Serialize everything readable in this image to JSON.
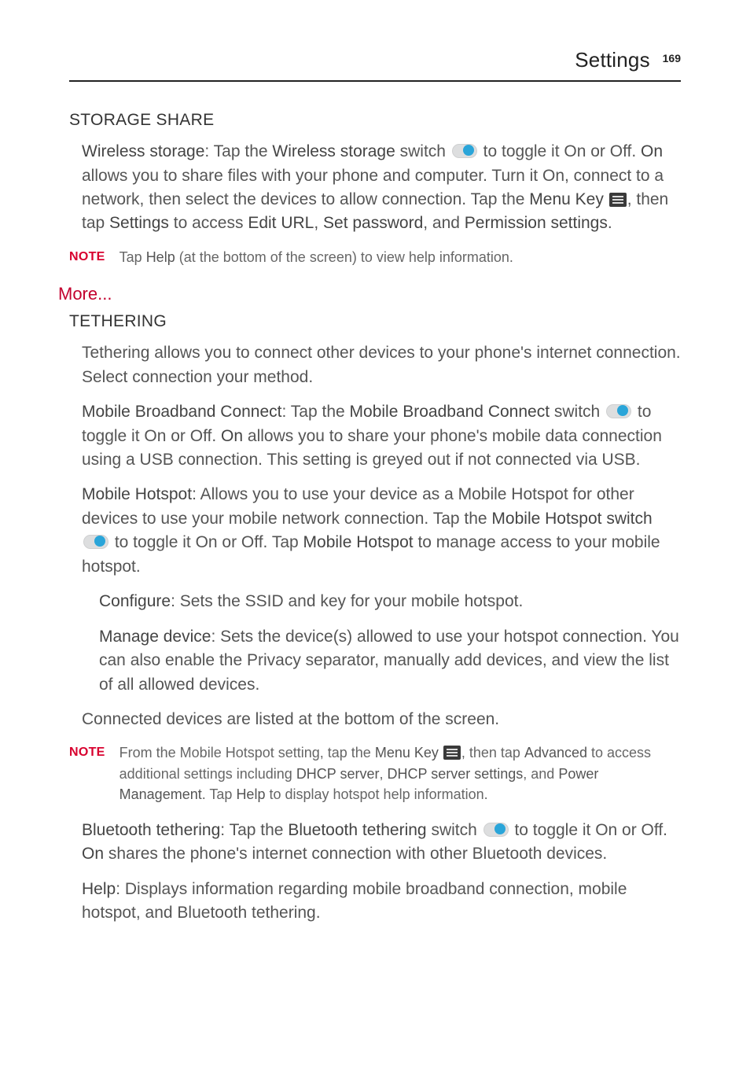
{
  "header": {
    "title": "Settings",
    "page": "169"
  },
  "storage_share": {
    "heading": "STORAGE SHARE",
    "ws_1a": "Wireless storage",
    "ws_1b": ": Tap the ",
    "ws_1c": "Wireless storage",
    "ws_1d": " switch ",
    "ws_1e": " to toggle it On or Off. ",
    "ws_1f": "On",
    "ws_1g": " allows you to share files with your phone and computer. Turn it On, connect to a network, then select the devices to allow connection. Tap the ",
    "ws_1h": "Menu Key ",
    "ws_1i": ", then tap ",
    "ws_1j": "Settings",
    "ws_1k": " to access ",
    "ws_1l": "Edit URL",
    "ws_1m": ", ",
    "ws_1n": "Set password",
    "ws_1o": ", and ",
    "ws_1p": "Permission settings",
    "ws_1q": ".",
    "note_label": "NOTE",
    "note1a": "Tap ",
    "note1b": "Help",
    "note1c": " (at the bottom of the screen) to view help information."
  },
  "more": {
    "heading": "More...",
    "tethering_heading": "TETHERING",
    "tether_intro": "Tethering allows you to connect other devices to your phone's internet connection. Select connection your method.",
    "mbc_a": "Mobile Broadband Connect",
    "mbc_b": ": Tap the ",
    "mbc_c": "Mobile Broadband Connect",
    "mbc_d": " switch ",
    "mbc_e": " to toggle it On or Off. ",
    "mbc_f": "On",
    "mbc_g": " allows you to share your phone's mobile data connection using a USB connection. This setting is greyed out if not connected via USB.",
    "mh_a": "Mobile Hotspot",
    "mh_b": ": Allows you to use your device as a Mobile Hotspot for other devices to use your mobile network connection. Tap the ",
    "mh_c": "Mobile Hotspot switch ",
    "mh_d": " to toggle it On or Off. Tap ",
    "mh_e": "Mobile Hotspot",
    "mh_f": " to manage access to your mobile hotspot.",
    "cfg_a": "Configure",
    "cfg_b": ": Sets the SSID and key for your mobile hotspot.",
    "md_a": "Manage device",
    "md_b": ": Sets the device(s) allowed to use your hotspot connection. You can also enable the Privacy separator, manually add devices, and view the list of all allowed devices.",
    "conn_dev": "Connected devices are listed at the bottom of the screen.",
    "note2_label": "NOTE",
    "note2_a": "From the Mobile Hotspot setting, tap the ",
    "note2_b": "Menu Key ",
    "note2_c": ", then tap ",
    "note2_d": "Advanced",
    "note2_e": " to access additional settings including ",
    "note2_f": "DHCP server",
    "note2_g": ", ",
    "note2_h": "DHCP server settings",
    "note2_i": ", and ",
    "note2_j": "Power Management",
    "note2_k": ". Tap ",
    "note2_l": "Help",
    "note2_m": " to display hotspot help information.",
    "bt_a": "Bluetooth tethering",
    "bt_b": ": Tap the ",
    "bt_c": "Bluetooth tethering",
    "bt_d": " switch ",
    "bt_e": " to toggle it On or Off. ",
    "bt_f": "On",
    "bt_g": " shares the phone's internet connection with other Bluetooth devices.",
    "help_a": "Help",
    "help_b": ": Displays information regarding mobile broadband connection, mobile hotspot, and Bluetooth tethering."
  }
}
